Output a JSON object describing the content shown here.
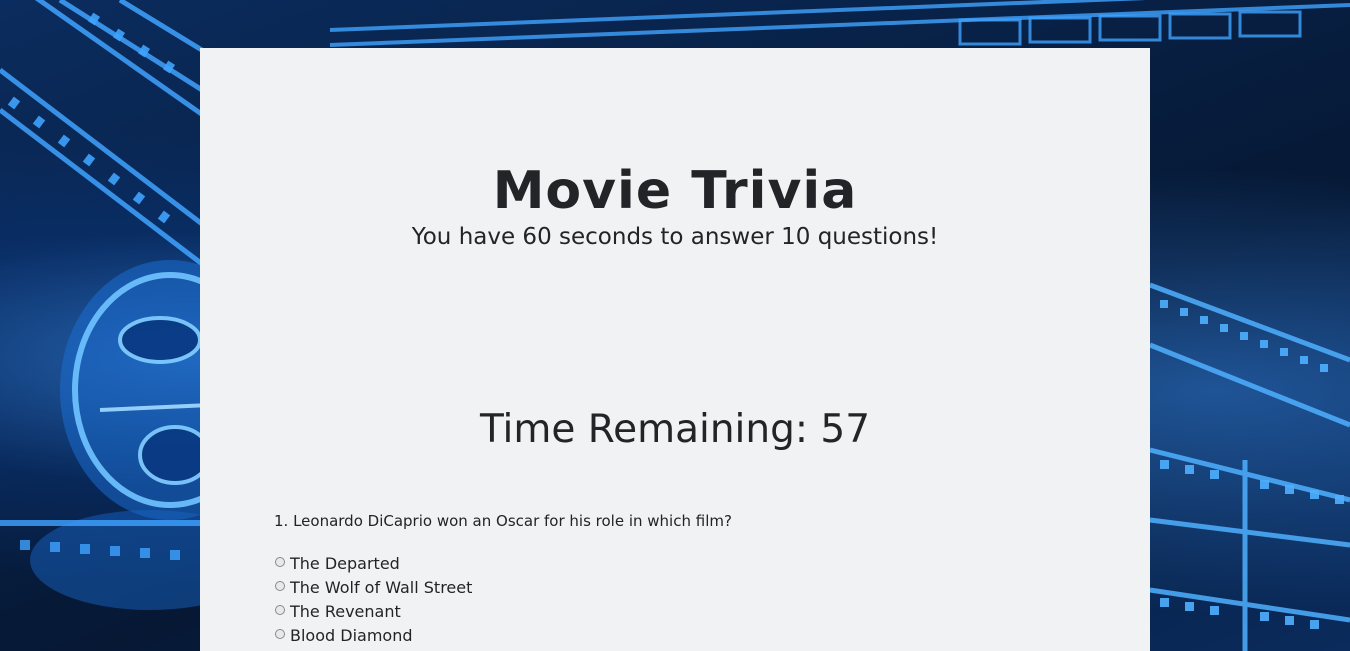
{
  "header": {
    "title": "Movie Trivia",
    "subtitle": "You have 60 seconds to answer 10 questions!"
  },
  "timer": {
    "label": "Time Remaining: 57"
  },
  "questions": [
    {
      "text": "1. Leonardo DiCaprio won an Oscar for his role in which film?",
      "options": [
        "The Departed",
        "The Wolf of Wall Street",
        "The Revenant",
        "Blood Diamond"
      ]
    }
  ],
  "colors": {
    "card_background": "#f1f2f4",
    "text": "#222428",
    "background_blue": "#0b2c5e",
    "accent_glow": "#3c96ff"
  }
}
